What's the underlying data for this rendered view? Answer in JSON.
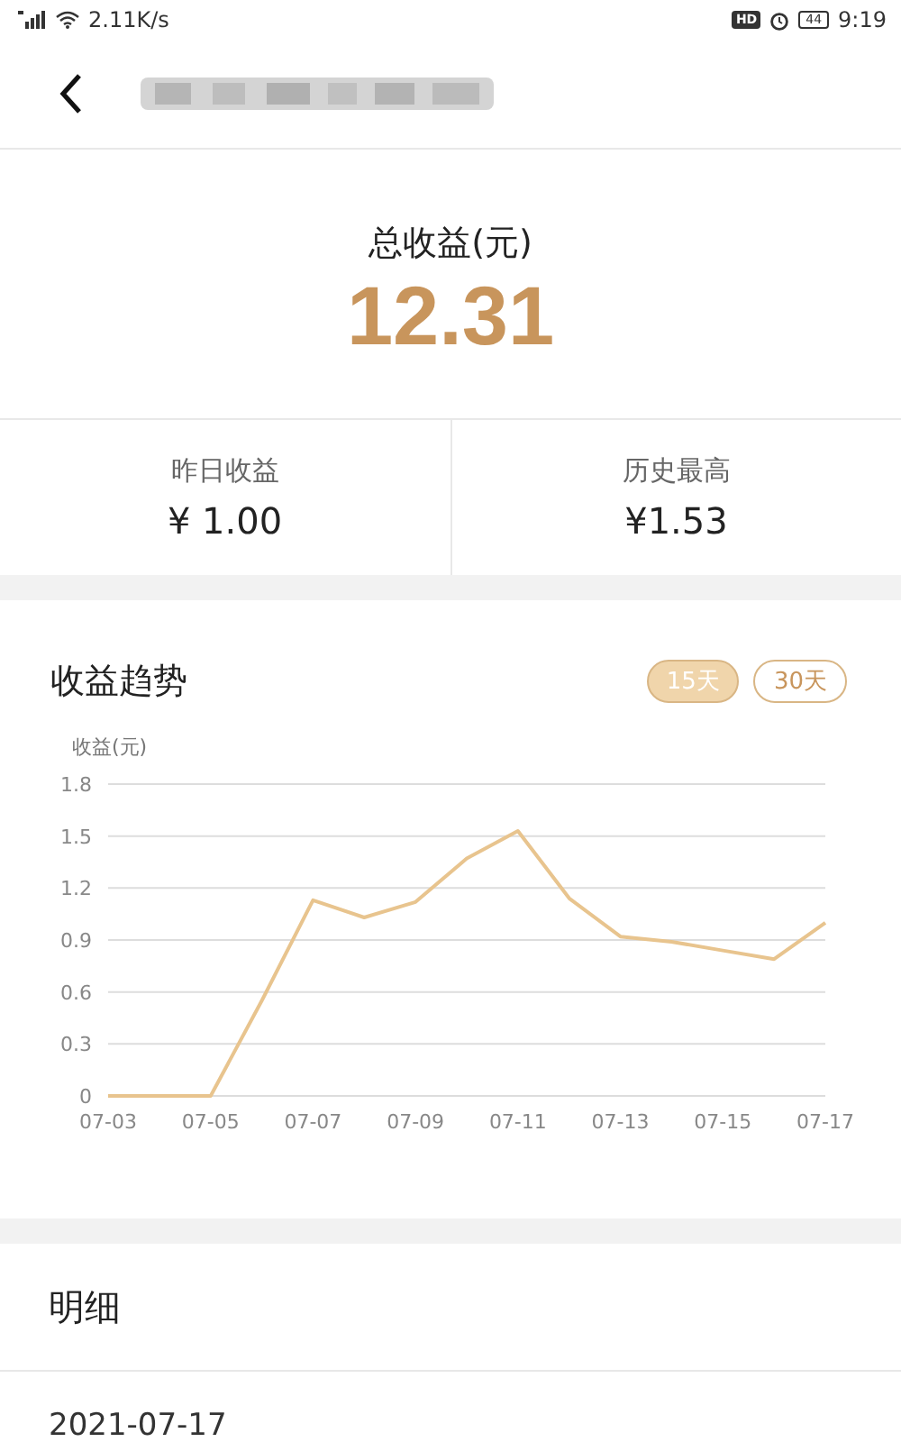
{
  "status_bar": {
    "speed": "2.11K/s",
    "hd": "HD",
    "battery": "44",
    "time": "9:19"
  },
  "summary": {
    "label": "总收益(元)",
    "value": "12.31"
  },
  "stats": [
    {
      "label": "昨日收益",
      "value": "¥ 1.00"
    },
    {
      "label": "历史最高",
      "value": "¥1.53"
    }
  ],
  "trend": {
    "title": "收益趋势",
    "ranges": [
      {
        "label": "15天",
        "selected": true
      },
      {
        "label": "30天",
        "selected": false
      }
    ],
    "chart_data": {
      "type": "line",
      "ylabel": "收益(元)",
      "categories": [
        "07-03",
        null,
        "07-05",
        null,
        "07-07",
        null,
        "07-09",
        null,
        "07-11",
        null,
        "07-13",
        null,
        "07-15",
        null,
        "07-17"
      ],
      "series": [
        {
          "color": "#e8c48e",
          "values": [
            0,
            0,
            0,
            0.55,
            1.13,
            1.03,
            1.12,
            1.37,
            1.53,
            1.14,
            0.92,
            0.89,
            0.84,
            0.79,
            1.0
          ]
        }
      ],
      "ylim": [
        0,
        1.8
      ],
      "yticks": [
        0,
        0.3,
        0.6,
        0.9,
        1.2,
        1.5,
        1.8
      ],
      "grid": true
    }
  },
  "details": {
    "title": "明细",
    "first_date": "2021-07-17"
  }
}
